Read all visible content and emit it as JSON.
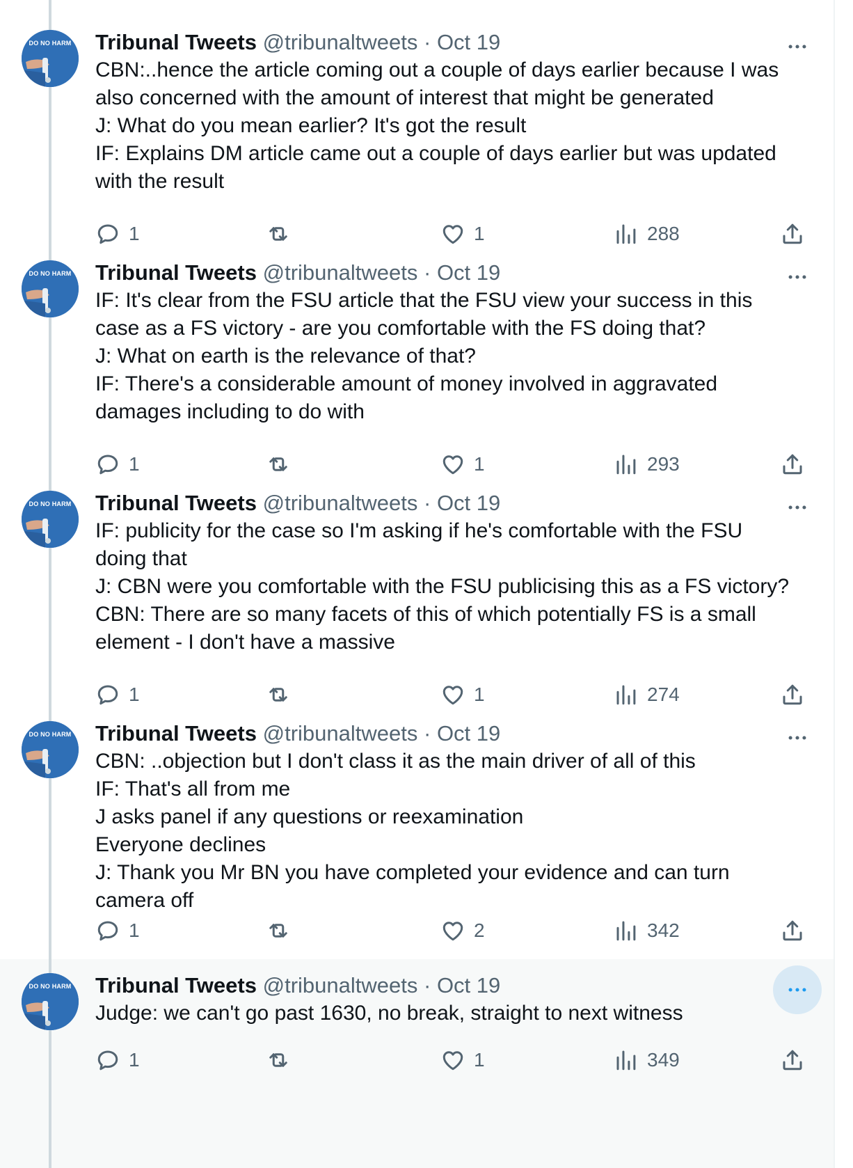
{
  "author": {
    "name": "Tribunal Tweets",
    "handle": "@tribunaltweets",
    "separator": "·",
    "avatar_text": "DO NO HARM"
  },
  "tweets": [
    {
      "date": "Oct 19",
      "lines": [
        "CBN:..hence the article coming out a couple of days earlier because I was",
        "also concerned with the amount of interest that might be generated",
        "J: What do you mean earlier? It's got the result",
        "IF: Explains DM article came out a couple of days earlier but was updated",
        "with the result"
      ],
      "replies": "1",
      "likes": "1",
      "views": "288"
    },
    {
      "date": "Oct 19",
      "lines": [
        "IF: It's clear from the FSU article that the FSU view your success in this",
        "case as a FS victory - are you comfortable with the FS doing that?",
        "J: What on earth is the relevance of that?",
        "IF: There's a considerable amount of money involved in aggravated",
        "damages including to do with"
      ],
      "replies": "1",
      "likes": "1",
      "views": "293"
    },
    {
      "date": "Oct 19",
      "lines": [
        "IF: publicity for the case so I'm asking if he's comfortable with the FSU",
        "doing that",
        "J: CBN were you comfortable with the FSU publicising this as a FS victory?",
        "CBN: There are so many facets of this of which potentially FS is a small",
        "element - I don't have a massive"
      ],
      "replies": "1",
      "likes": "1",
      "views": "274"
    },
    {
      "date": "Oct 19",
      "lines": [
        "CBN: ..objection but I don't class it as the main driver of all of this",
        "IF: That's all from me",
        "J asks panel if any questions or reexamination",
        "Everyone declines",
        "J: Thank you Mr BN you have completed your evidence and can turn",
        "camera off"
      ],
      "replies": "1",
      "likes": "2",
      "views": "342"
    },
    {
      "date": "Oct 19",
      "lines": [
        "Judge: we can't go past 1630, no break, straight to next witness"
      ],
      "replies": "1",
      "likes": "1",
      "views": "349",
      "highlighted": true
    }
  ],
  "colors": {
    "text": "#0f1419",
    "secondary": "#536471",
    "thread_line": "#cfd9de",
    "highlight_bg": "#f7f9f9",
    "more_active_bg": "#d8e9f5",
    "more_active_icon": "#1d9bf0"
  },
  "icons": {
    "reply": "reply-icon",
    "retweet": "retweet-icon",
    "like": "like-icon",
    "views": "views-icon",
    "share": "share-icon",
    "more": "more-icon"
  }
}
